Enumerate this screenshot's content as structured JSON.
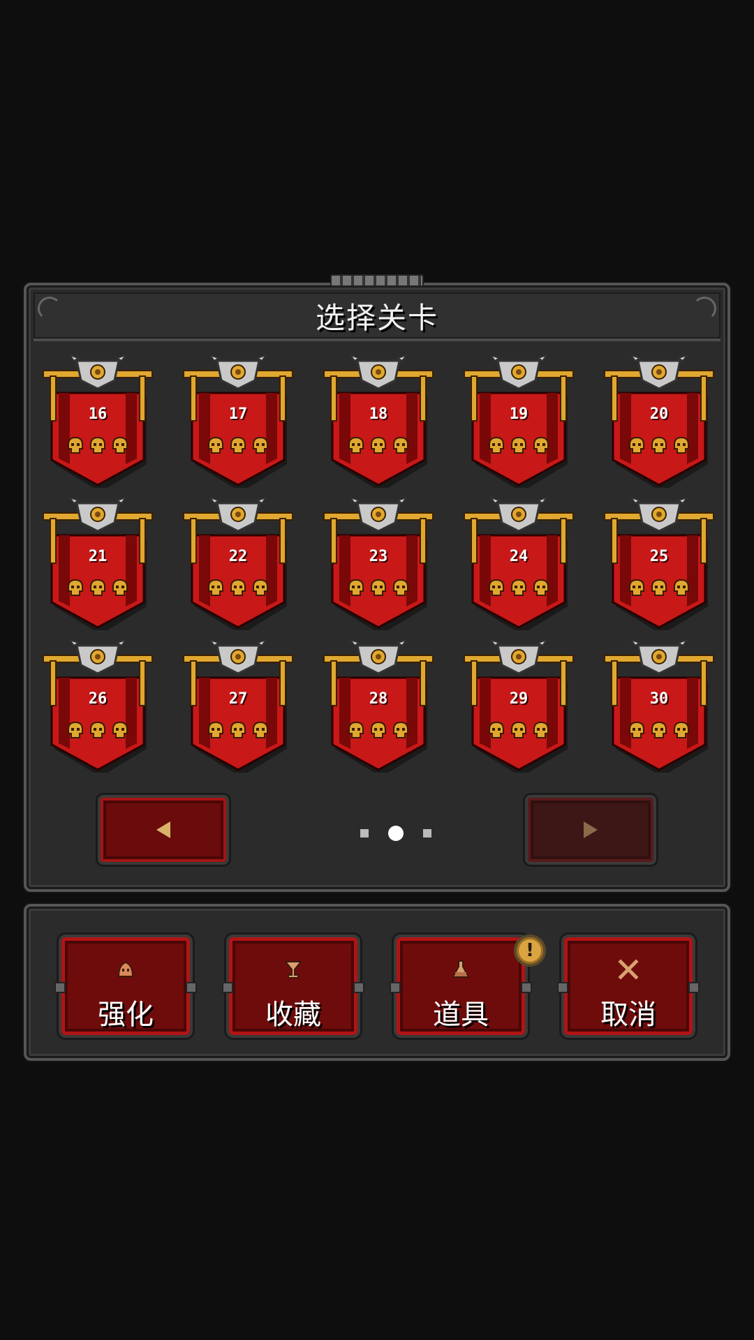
{
  "dialog": {
    "title": "选择关卡"
  },
  "levels": [
    {
      "number": "16",
      "skulls": 3
    },
    {
      "number": "17",
      "skulls": 3
    },
    {
      "number": "18",
      "skulls": 3
    },
    {
      "number": "19",
      "skulls": 3
    },
    {
      "number": "20",
      "skulls": 3
    },
    {
      "number": "21",
      "skulls": 3
    },
    {
      "number": "22",
      "skulls": 3
    },
    {
      "number": "23",
      "skulls": 3
    },
    {
      "number": "24",
      "skulls": 3
    },
    {
      "number": "25",
      "skulls": 3
    },
    {
      "number": "26",
      "skulls": 3
    },
    {
      "number": "27",
      "skulls": 3
    },
    {
      "number": "28",
      "skulls": 3
    },
    {
      "number": "29",
      "skulls": 3
    },
    {
      "number": "30",
      "skulls": 3
    }
  ],
  "pagination": {
    "total_pages": 3,
    "current_page": 2,
    "prev_icon": "arrow-left-icon",
    "next_icon": "arrow-right-icon"
  },
  "toolbar": {
    "buttons": [
      {
        "label": "强化",
        "icon": "slime-icon"
      },
      {
        "label": "收藏",
        "icon": "chalice-icon"
      },
      {
        "label": "道具",
        "icon": "potion-flask-icon",
        "badge": "!"
      },
      {
        "label": "取消",
        "icon": "cross-swords-icon"
      }
    ]
  },
  "colors": {
    "banner_red": "#c81818",
    "banner_dark": "#7a0808",
    "gold": "#e0a830",
    "panel_bg": "#2b2b2b",
    "button_red": "#6e0c0c"
  }
}
